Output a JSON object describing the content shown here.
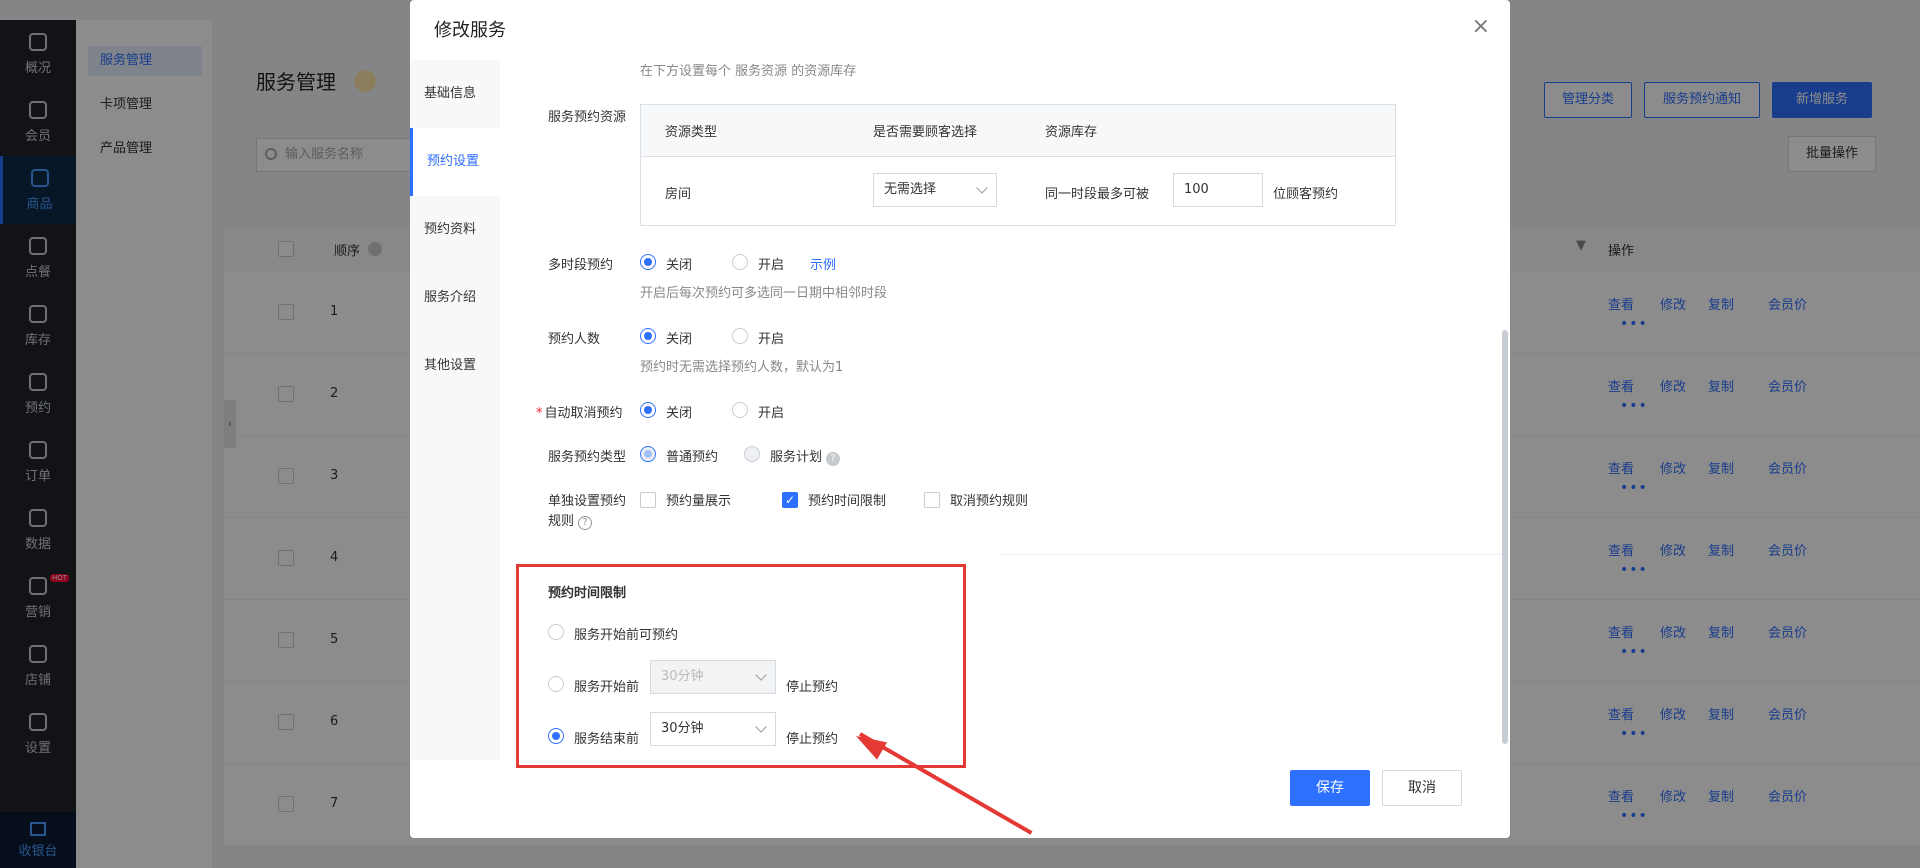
{
  "nav": {
    "items": [
      {
        "label": "概况",
        "icon": "grid-icon"
      },
      {
        "label": "会员",
        "icon": "crown-icon"
      },
      {
        "label": "商品",
        "icon": "shop-icon"
      },
      {
        "label": "点餐",
        "icon": "dish-icon"
      },
      {
        "label": "库存",
        "icon": "inventory-icon"
      },
      {
        "label": "预约",
        "icon": "calendar-check-icon"
      },
      {
        "label": "订单",
        "icon": "order-icon"
      },
      {
        "label": "数据",
        "icon": "chart-icon"
      },
      {
        "label": "营销",
        "icon": "gift-icon",
        "badge": "HOT"
      },
      {
        "label": "店铺",
        "icon": "store-icon"
      },
      {
        "label": "设置",
        "icon": "gear-icon"
      }
    ],
    "active_index": 2,
    "bottom_label": "收银台"
  },
  "submenu": {
    "items": [
      "服务管理",
      "卡项管理",
      "产品管理"
    ],
    "active_index": 0
  },
  "page": {
    "title": "服务管理",
    "search_placeholder": "输入服务名称",
    "buttons": {
      "manage_category": "管理分类",
      "booking_notice": "服务预约通知",
      "add_service": "新增服务",
      "bulk": "批量操作"
    },
    "columns": {
      "order": "顺序",
      "action": "操作"
    },
    "rows": [
      "1",
      "2",
      "3",
      "4",
      "5",
      "6",
      "7"
    ],
    "row_actions": [
      "查看",
      "修改",
      "复制",
      "会员价"
    ],
    "more": "•••"
  },
  "modal": {
    "title": "修改服务",
    "close": "×",
    "tabs": [
      "基础信息",
      "预约设置",
      "预约资料",
      "服务介绍",
      "其他设置"
    ],
    "active_tab": 1,
    "resource_hint": "在下方设置每个 服务资源 的资源库存",
    "resource_label": "服务预约资源",
    "resource_table": {
      "headers": [
        "资源类型",
        "是否需要顾客选择",
        "资源库存"
      ],
      "row": {
        "type": "房间",
        "select_value": "无需选择",
        "stock_prefix": "同一时段最多可被",
        "stock_value": "100",
        "stock_suffix": "位顾客预约"
      }
    },
    "multi_period": {
      "label": "多时段预约",
      "off": "关闭",
      "on": "开启",
      "selected": "off",
      "example_link": "示例",
      "hint": "开启后每次预约可多选同一日期中相邻时段"
    },
    "people": {
      "label": "预约人数",
      "off": "关闭",
      "on": "开启",
      "selected": "off",
      "hint": "预约时无需选择预约人数，默认为1"
    },
    "auto_cancel": {
      "required_mark": "*",
      "label": "自动取消预约",
      "off": "关闭",
      "on": "开启",
      "selected": "off"
    },
    "booking_type": {
      "label": "服务预约类型",
      "normal": "普通预约",
      "plan": "服务计划",
      "selected": "normal"
    },
    "rules": {
      "label_line1": "单独设置预约",
      "label_line2": "规则",
      "options": [
        {
          "label": "预约量展示",
          "checked": false
        },
        {
          "label": "预约时间限制",
          "checked": true
        },
        {
          "label": "取消预约规则",
          "checked": false
        }
      ]
    },
    "time_limit": {
      "title": "预约时间限制",
      "option1": "服务开始前可预约",
      "option2_prefix": "服务开始前",
      "option2_value": "30分钟",
      "option2_suffix": "停止预约",
      "option3_prefix": "服务结束前",
      "option3_value": "30分钟",
      "option3_suffix": "停止预约",
      "selected": 3
    },
    "save": "保存",
    "cancel": "取消"
  },
  "colors": {
    "primary": "#2d6fff",
    "annotation_red": "#e53935",
    "nav_bg": "#1f2329"
  }
}
